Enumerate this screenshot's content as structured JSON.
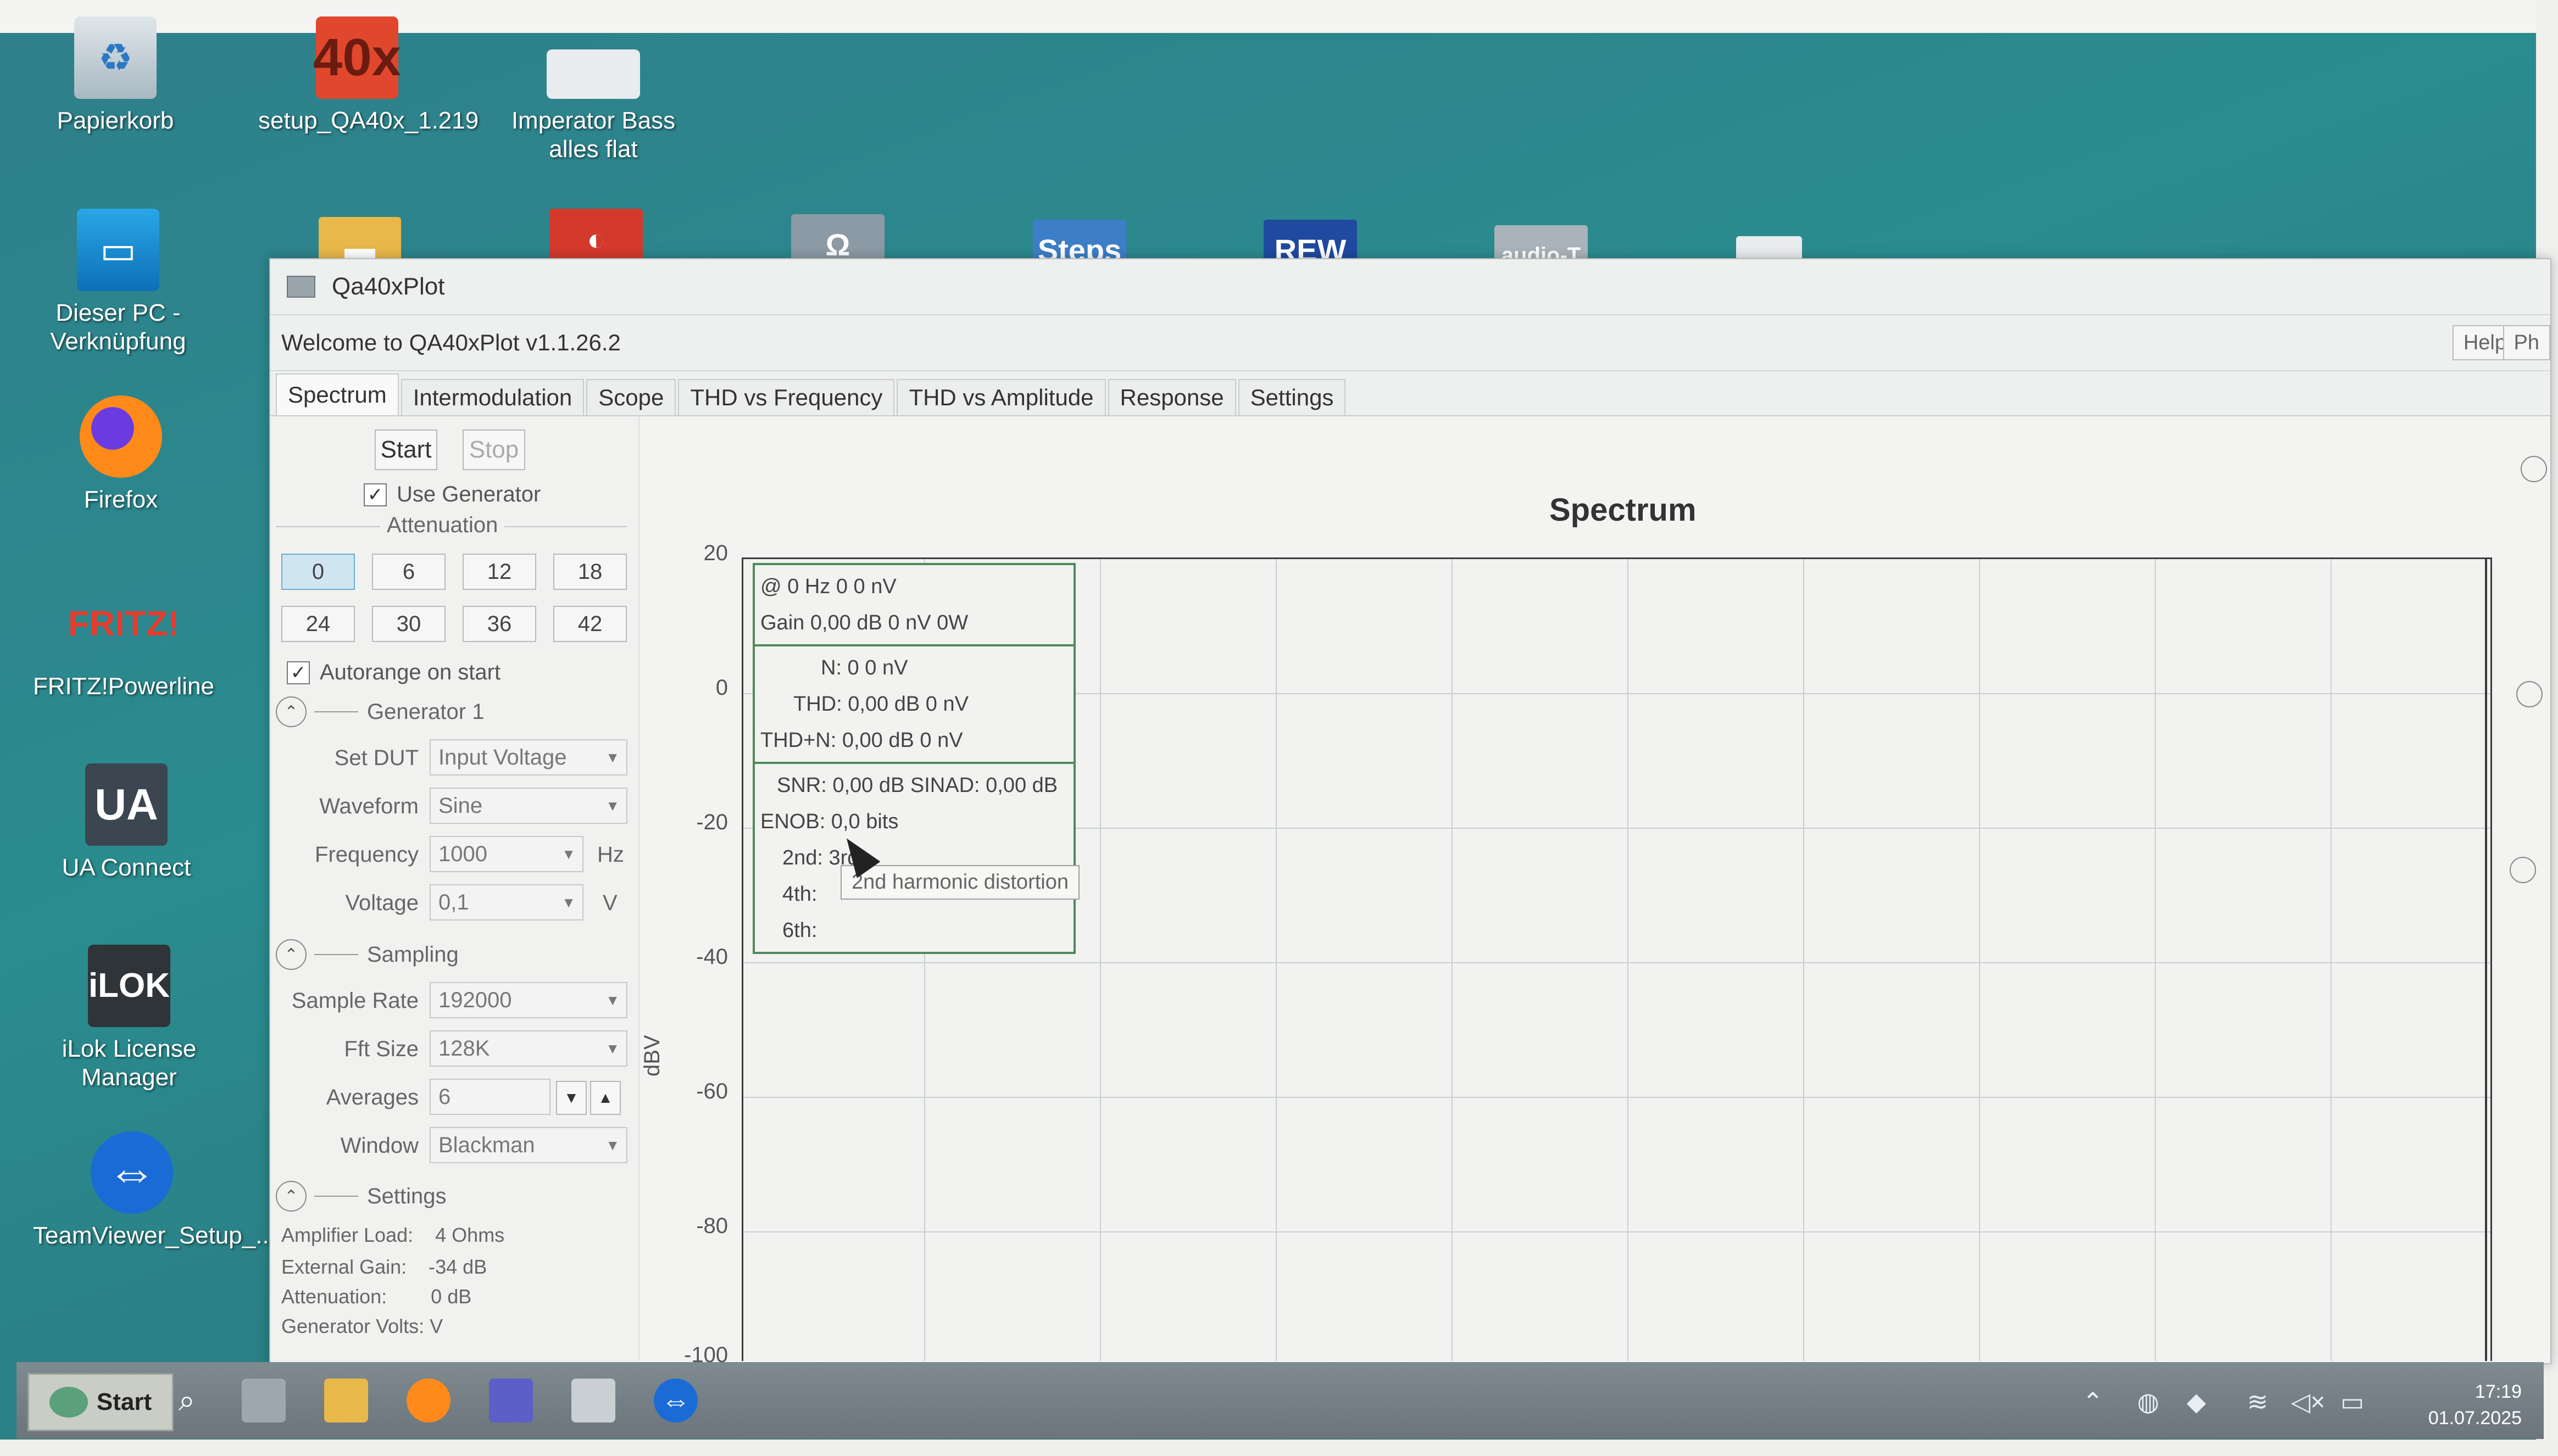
{
  "desktop": {
    "icons": [
      {
        "label": "Papierkorb",
        "glyph": "recycle-bin-icon",
        "sym": "♻"
      },
      {
        "label": "setup_QA40x_1.219",
        "glyph": "qa40x-installer-icon",
        "sym": "40x"
      },
      {
        "label": "Imperator Bass alles flat",
        "glyph": "file-icon",
        "sym": ""
      },
      {
        "label": "Dieser PC - Verknüpfung",
        "glyph": "computer-icon",
        "sym": "▭"
      },
      {
        "label": "Firefox",
        "glyph": "firefox-icon",
        "sym": "●"
      },
      {
        "label": "FRITZ!Powerline",
        "glyph": "fritz-icon",
        "sym": "FRITZ!"
      },
      {
        "label": "UA Connect",
        "glyph": "ua-connect-icon",
        "sym": "UA"
      },
      {
        "label": "iLok License Manager",
        "glyph": "ilok-icon",
        "sym": "iLOK"
      },
      {
        "label": "TeamViewer_Setup_...",
        "glyph": "teamviewer-icon",
        "sym": "⇔"
      }
    ],
    "top_row": [
      {
        "label": "",
        "glyph": "folder-icon",
        "sym": "▬",
        "color": "#e8b84a"
      },
      {
        "label": "",
        "glyph": "app-icon",
        "sym": "◐",
        "color": "#d33a2c"
      },
      {
        "label": "",
        "glyph": "audio-icon",
        "sym": "Ω",
        "color": "#8c9aa5"
      },
      {
        "label": "Steps",
        "glyph": "steps-icon",
        "sym": "Steps",
        "color": "#3c7ec7"
      },
      {
        "label": "REW",
        "glyph": "rew-icon",
        "sym": "REW",
        "color": "#1f4aa0"
      },
      {
        "label": "audio-T",
        "glyph": "audiot-icon",
        "sym": "audio-T",
        "color": "#a9b3ba"
      },
      {
        "label": "",
        "glyph": "document-icon",
        "sym": "≡",
        "color": "#e9ecee"
      }
    ]
  },
  "window": {
    "title": "Qa40xPlot",
    "welcome": "Welcome to QA40xPlot v1.1.26.2",
    "help_label": "Help",
    "ph_label": "Ph",
    "tabs": [
      "Spectrum",
      "Intermodulation",
      "Scope",
      "THD vs Frequency",
      "THD vs Amplitude",
      "Response",
      "Settings"
    ],
    "active_tab": "Spectrum"
  },
  "left": {
    "start": "Start",
    "stop": "Stop",
    "use_generator": "Use Generator",
    "attenuation_title": "Attenuation",
    "attenuation": [
      "0",
      "6",
      "12",
      "18",
      "24",
      "30",
      "36",
      "42"
    ],
    "attenuation_selected": "0",
    "autorange": "Autorange on start",
    "generator_title": "Generator 1",
    "set_dut_label": "Set DUT",
    "set_dut_value": "Input Voltage",
    "waveform_label": "Waveform",
    "waveform_value": "Sine",
    "frequency_label": "Frequency",
    "frequency_value": "1000",
    "frequency_unit": "Hz",
    "voltage_label": "Voltage",
    "voltage_value": "0,1",
    "voltage_unit": "V",
    "sampling_title": "Sampling",
    "sample_rate_label": "Sample Rate",
    "sample_rate_value": "192000",
    "fft_label": "Fft Size",
    "fft_value": "128K",
    "averages_label": "Averages",
    "averages_value": "6",
    "window_label": "Window",
    "window_value": "Blackman",
    "settings_title": "Settings",
    "info": [
      {
        "k": "Amplifier Load:",
        "v": "4 Ohms"
      },
      {
        "k": "External Gain:",
        "v": "-34 dB"
      },
      {
        "k": "Attenuation:",
        "v": "0 dB"
      },
      {
        "k": "Generator Volts:",
        "v": "V"
      }
    ]
  },
  "plot": {
    "title": "Spectrum",
    "ylabel": "dBV",
    "yticks": [
      "20",
      "0",
      "-20",
      "-40",
      "-60",
      "-80",
      "-100"
    ],
    "legend": {
      "l1": "@ 0 Hz          0       0 nV",
      "l2": "Gain 0,00 dB 0 nV  0W",
      "l3": "N: 0          0 nV",
      "l4": "THD: 0,00 dB 0 nV",
      "l5": "THD+N: 0,00 dB 0 nV",
      "l6": "SNR: 0,00 dB SINAD: 0,00 dB",
      "l7": "ENOB: 0,0 bits",
      "l8": "2nd:                3rd:",
      "l9": "4th:",
      "l10": "6th:"
    },
    "tooltip": "2nd harmonic distortion"
  },
  "taskbar": {
    "start": "Start",
    "time": "17:19",
    "date": "01.07.2025",
    "apps": [
      "search-icon",
      "task-view-icon",
      "explorer-icon",
      "firefox-icon",
      "teams-icon",
      "qa40xplot-icon",
      "teamviewer-icon"
    ]
  }
}
